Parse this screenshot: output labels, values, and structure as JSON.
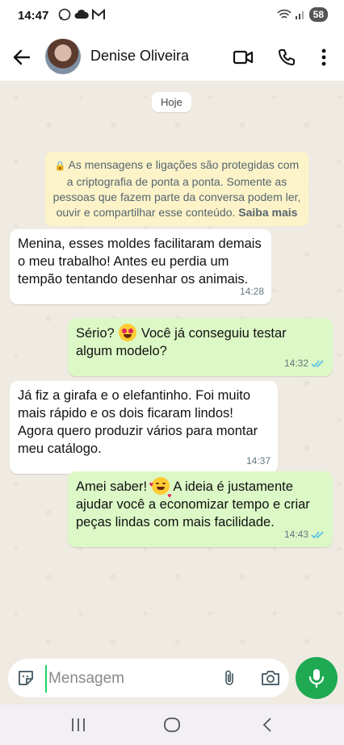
{
  "status_bar": {
    "time": "14:47",
    "left_icons": [
      "whatsapp-icon",
      "cloud-icon",
      "gmail-icon"
    ],
    "right_icons": [
      "wifi-icon",
      "signal-icon"
    ],
    "battery": "58"
  },
  "header": {
    "contact_name": "Denise Oliveira",
    "actions": [
      "video-call-icon",
      "phone-icon",
      "more-icon"
    ]
  },
  "chat": {
    "date_chip": "Hoje",
    "security_notice": {
      "text": "As mensagens e ligações são protegidas com a criptografia de ponta a ponta. Somente as pessoas que fazem parte da conversa podem ler, ouvir e compartilhar esse conteúdo.",
      "link": "Saiba mais"
    },
    "messages": [
      {
        "direction": "in",
        "text": "Menina, esses moldes facilitaram demais o meu trabalho! Antes eu perdia um tempão tentando desenhar os animais.",
        "time": "14:28"
      },
      {
        "direction": "out",
        "text_before": "Sério?",
        "emoji": "heart-eyes-emoji",
        "text_after": "Você já conseguiu testar algum modelo?",
        "time": "14:32",
        "status": "read"
      },
      {
        "direction": "in",
        "text": "Já fiz a girafa e o elefantinho. Foi muito mais rápido e os dois ficaram lindos! Agora quero produzir vários para montar meu catálogo.",
        "time": "14:37"
      },
      {
        "direction": "out",
        "text_before": "Amei saber!",
        "emoji": "smiling-hearts-emoji",
        "text_after": "A ideia é justamente ajudar você a economizar tempo e criar peças lindas com mais facilidade.",
        "time": "14:43",
        "status": "read"
      }
    ]
  },
  "composer": {
    "placeholder": "Mensagem"
  },
  "colors": {
    "outgoing_bubble": "#dcf8c6",
    "incoming_bubble": "#ffffff",
    "chat_background": "#efeae2",
    "notice_background": "#fdf3c9",
    "accent_green": "#1ea952",
    "read_ticks": "#53bdeb"
  }
}
